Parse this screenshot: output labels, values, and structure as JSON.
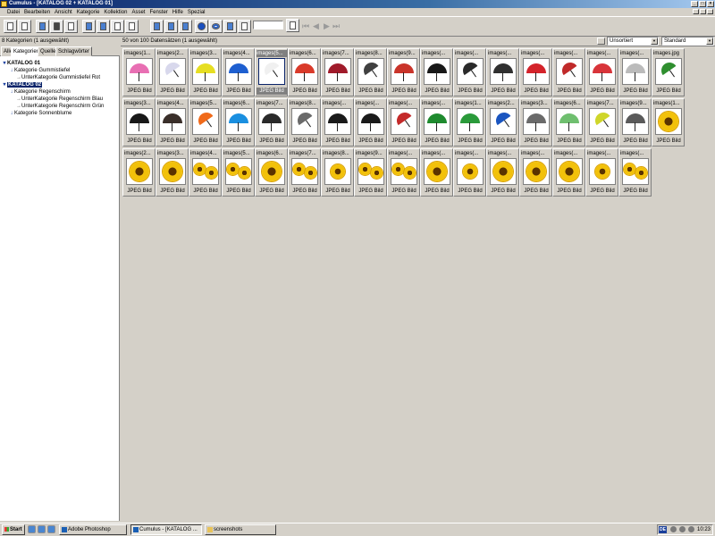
{
  "window": {
    "title": "Cumulus - [KATALOG 02 + KATALOG 01]"
  },
  "menu": [
    "Datei",
    "Bearbeiten",
    "Ansicht",
    "Kategorie",
    "Kollektion",
    "Asset",
    "Fenster",
    "Hilfe",
    "Spezial"
  ],
  "left_panel": {
    "header": "8 Kategorien (1 ausgewählt)",
    "tabs": [
      "Alle",
      "Kategorien",
      "Quellen",
      "Schlagwörter"
    ],
    "active_tab": "Kategorien",
    "tree": [
      {
        "label": "KATALOG 01",
        "level": 0,
        "bold": true,
        "selected": false
      },
      {
        "label": "Kategorie Gummistiefel",
        "level": 1,
        "bold": false,
        "selected": false
      },
      {
        "label": "UnterKategorie Gummistiefel Rot",
        "level": 2,
        "bold": false,
        "selected": false
      },
      {
        "label": "KATALOG 02",
        "level": 0,
        "bold": true,
        "selected": true
      },
      {
        "label": "Kategorie Regenschirm",
        "level": 1,
        "bold": false,
        "selected": false
      },
      {
        "label": "UnterKategorie Regenschirm Blau",
        "level": 2,
        "bold": false,
        "selected": false
      },
      {
        "label": "UnterKategorie Regenschirm Grün",
        "level": 2,
        "bold": false,
        "selected": false
      },
      {
        "label": "Kategorie Sonnenblume",
        "level": 1,
        "bold": false,
        "selected": false
      }
    ]
  },
  "main_panel": {
    "header": "50 von 100 Datensätzen (1 ausgewählt)",
    "sort_select": "Unsortiert",
    "view_select": "Standard",
    "type_label": "JPEG Bild",
    "items": [
      {
        "name": "images(1...",
        "kind": "umb",
        "c": "#e86fb3",
        "bg": "white"
      },
      {
        "name": "images(2...",
        "kind": "umb",
        "c": "#d8d8ec",
        "bg": "white"
      },
      {
        "name": "images(3...",
        "kind": "umb",
        "c": "#e6de22",
        "bg": "white"
      },
      {
        "name": "images(4...",
        "kind": "umb",
        "c": "#1e5fd0",
        "bg": "white"
      },
      {
        "name": "images(5...",
        "kind": "umb",
        "c": "#f0f0f0",
        "bg": "green",
        "selected": true
      },
      {
        "name": "images(6...",
        "kind": "umb",
        "c": "#d93a2a",
        "bg": "white"
      },
      {
        "name": "images(7...",
        "kind": "umb",
        "c": "#a01a2a",
        "bg": "white"
      },
      {
        "name": "images(8...",
        "kind": "umb",
        "c": "#404040",
        "bg": "brown"
      },
      {
        "name": "images(9...",
        "kind": "umb",
        "c": "#c9342a",
        "bg": "grey"
      },
      {
        "name": "images(...",
        "kind": "umb",
        "c": "#181818",
        "bg": "white"
      },
      {
        "name": "images(...",
        "kind": "umb",
        "c": "#2a2a2a",
        "bg": "grey"
      },
      {
        "name": "images(...",
        "kind": "umb",
        "c": "#303030",
        "bg": "grey"
      },
      {
        "name": "images(...",
        "kind": "umb",
        "c": "#d4232a",
        "bg": "white"
      },
      {
        "name": "images(...",
        "kind": "umb",
        "c": "#c02a2a",
        "bg": "brown"
      },
      {
        "name": "images(...",
        "kind": "umb",
        "c": "#d8343a",
        "bg": "white"
      },
      {
        "name": "images(...",
        "kind": "umb",
        "c": "#bbbbbb",
        "bg": "white"
      },
      {
        "name": "images.jpg",
        "kind": "umb",
        "c": "#2f8f2f",
        "bg": "white"
      },
      {
        "name": "images(3...",
        "kind": "umb",
        "c": "#181818",
        "bg": "white"
      },
      {
        "name": "images(4...",
        "kind": "umb",
        "c": "#3a2f2a",
        "bg": "brown"
      },
      {
        "name": "images(5...",
        "kind": "umb",
        "c": "#f06a1a",
        "bg": "white"
      },
      {
        "name": "images(6...",
        "kind": "umb",
        "c": "#1a8fe0",
        "bg": "navy"
      },
      {
        "name": "images(7...",
        "kind": "umb",
        "c": "#2a2a2a",
        "bg": "grey"
      },
      {
        "name": "images(8...",
        "kind": "umb",
        "c": "#6a6a6a",
        "bg": "grey"
      },
      {
        "name": "images(...",
        "kind": "umb",
        "c": "#1a1a1a",
        "bg": "white"
      },
      {
        "name": "images(...",
        "kind": "umb",
        "c": "#1a1a1a",
        "bg": "white"
      },
      {
        "name": "images(...",
        "kind": "umb",
        "c": "#c42a2a",
        "bg": "grey"
      },
      {
        "name": "images(...",
        "kind": "umb",
        "c": "#1e8a2e",
        "bg": "white"
      },
      {
        "name": "images(1...",
        "kind": "umb",
        "c": "#2a9a3a",
        "bg": "white"
      },
      {
        "name": "images(2...",
        "kind": "umb",
        "c": "#1a55c0",
        "bg": "white"
      },
      {
        "name": "images(3...",
        "kind": "umb",
        "c": "#6a6a6a",
        "bg": "white"
      },
      {
        "name": "images(6...",
        "kind": "umb",
        "c": "#6fbf6f",
        "bg": "white"
      },
      {
        "name": "images(7...",
        "kind": "umb",
        "c": "#cfd62a",
        "bg": "yellowgreen"
      },
      {
        "name": "images(9...",
        "kind": "umb",
        "c": "#5a5a5a",
        "bg": "grey"
      },
      {
        "name": "images(1...",
        "kind": "sun",
        "c": "#f2c10a",
        "bg": "dark"
      },
      {
        "name": "images(2...",
        "kind": "sun",
        "c": "#f2c10a",
        "bg": "grass"
      },
      {
        "name": "images(3...",
        "kind": "sun",
        "c": "#f2c10a",
        "bg": "sky"
      },
      {
        "name": "images(4...",
        "kind": "sun2",
        "c": "#f2c10a",
        "bg": "grass"
      },
      {
        "name": "images(5...",
        "kind": "sun2",
        "c": "#f2c10a",
        "bg": "navy"
      },
      {
        "name": "images(6...",
        "kind": "sun",
        "c": "#f2c10a",
        "bg": "white"
      },
      {
        "name": "images(7...",
        "kind": "sun2",
        "c": "#f2c10a",
        "bg": "grass"
      },
      {
        "name": "images(8...",
        "kind": "sun",
        "c": "#f2c10a",
        "bg": "white"
      },
      {
        "name": "images(9...",
        "kind": "sun2",
        "c": "#f2c10a",
        "bg": "grass"
      },
      {
        "name": "images(...",
        "kind": "sun2",
        "c": "#f2c10a",
        "bg": "sky"
      },
      {
        "name": "images(...",
        "kind": "sun",
        "c": "#f2c10a",
        "bg": "sky"
      },
      {
        "name": "images(...",
        "kind": "sun",
        "c": "#f2c10a",
        "bg": "navy"
      },
      {
        "name": "images(...",
        "kind": "sun",
        "c": "#f2c10a",
        "bg": "white"
      },
      {
        "name": "images(...",
        "kind": "sun",
        "c": "#f2c10a",
        "bg": "navy"
      },
      {
        "name": "images(...",
        "kind": "sun",
        "c": "#f2c10a",
        "bg": "dark"
      },
      {
        "name": "images(...",
        "kind": "sun",
        "c": "#f2c10a",
        "bg": "navy"
      },
      {
        "name": "images(...",
        "kind": "sun2",
        "c": "#f2c10a",
        "bg": "dark"
      }
    ]
  },
  "taskbar": {
    "start_label": "Start",
    "tasks": [
      {
        "label": "Adobe Photoshop",
        "active": false
      },
      {
        "label": "Cumulus - [KATALOG ...",
        "active": true
      },
      {
        "label": "screenshots",
        "active": false
      }
    ],
    "lang": "DE",
    "clock": "10:23"
  }
}
